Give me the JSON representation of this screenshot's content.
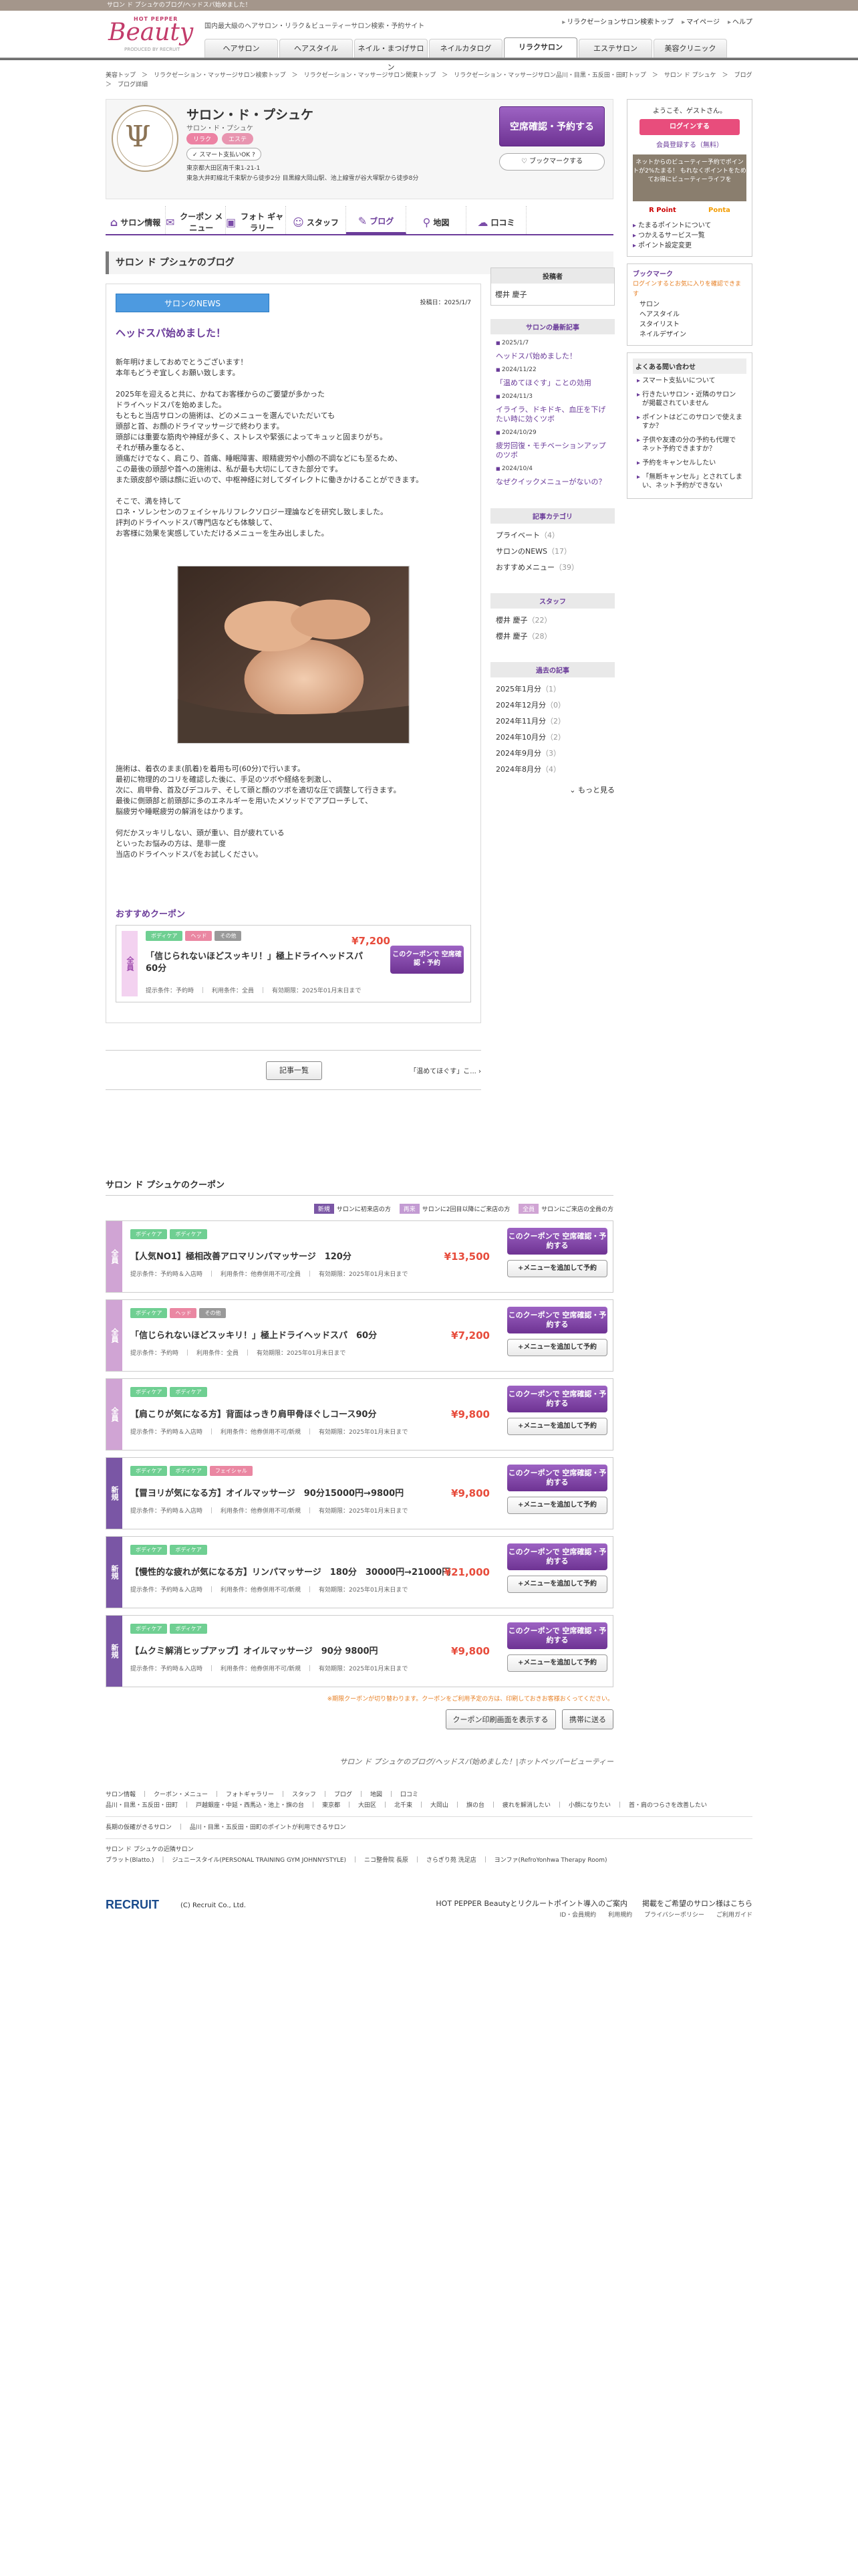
{
  "topbar": "サロン ド プシュケのブログ/ヘッドスパ始めました！",
  "logo": {
    "hp": "HOT PEPPER",
    "beauty": "Beauty",
    "by": "PRODUCED BY RECRUIT"
  },
  "tagline": "国内最大級のヘアサロン・リラク＆ビューティーサロン検索・予約サイト",
  "util": [
    "リラクゼーションサロン検索トップ",
    "マイページ",
    "ヘルプ"
  ],
  "gnav": [
    "ヘアサロン",
    "ヘアスタイル",
    "ネイル・まつげサロン",
    "ネイルカタログ",
    "リラクサロン",
    "エステサロン",
    "美容クリニック"
  ],
  "breadcrumb": "美容トップ　＞　リラクゼーション・マッサージサロン検索トップ　＞　リラクゼーション・マッサージサロン関東トップ　＞　リラクゼーション・マッサージサロン品川・目黒・五反田・田町トップ　＞　サロン ド プシュケ　＞　ブログ　＞　ブログ詳細",
  "shop": {
    "name": "サロン・ド・プシュケ",
    "kana": "サロン・ド・プシュケ",
    "tags": [
      "リラク",
      "エステ"
    ],
    "smart": "スマート支払いOK",
    "addr1": "東京都大田区南千束1-21-1",
    "addr2": "東急大井町線北千束駅から徒歩2分 目黒線大岡山駅、池上線雪が谷大塚駅から徒歩8分",
    "rsv": "空席確認・予約する",
    "bookmark": "ブックマークする"
  },
  "tabs": [
    "サロン情報",
    "クーポン メニュー",
    "フォト ギャラリー",
    "スタッフ",
    "ブログ",
    "地図",
    "口コミ"
  ],
  "blog": {
    "section": "サロン ド プシュケのブログ",
    "category": "サロンのNEWS",
    "date": "投稿日：2025/1/7",
    "title": "ヘッドスパ始めました！",
    "body1": "新年明けましておめでとうございます！\n本年もどうぞ宜しくお願い致します。\n\n2025年を迎えると共に、かねてお客様からのご要望が多かった\nドライヘッドスパを始めました。\nもともと当店サロンの施術は、どのメニューを選んでいただいても\n頭部と首、お顔のドライマッサージで終わります。\n頭部には重要な筋肉や神経が多く、ストレスや緊張によってキュッと固まりがち。\nそれが積み重なると、\n頭痛だけでなく、肩こり、首痛、睡眠障害、眼精疲労や小顔の不調などにも至るため、\nこの最後の頭部や首への施術は、私が最も大切にしてきた部分です。\nまた頭皮部や頭は顔に近いので、中枢神経に対してダイレクトに働きかけることができます。\n\nそこで、満を持して\nロネ・ソレンセンのフェイシャルリフレクソロジー理論などを研究し致しました。\n評判のドライヘッドスパ専門店なども体験して、\nお客様に効果を実感していただけるメニューを生み出しました。",
    "body2": "施術は、着衣のまま(肌着)を着用も可(60分)で行います。\n最初に物理的のコリを確認した後に、手足のツボや経絡を刺激し、\n次に、肩甲骨、首及びデコルテ、そして頭と顔のツボを適切な圧で調整して行きます。\n最後に側頭部と前頭部に多のエネルギーを用いたメソッドでアプローチして、\n脳疲労や睡眠疲労の解消をはかります。\n\n何だかスッキリしない、頭が重い、目が疲れている\nといったお悩みの方は、是非一度\n当店のドライヘッドスパをお試しください。",
    "rec_head": "おすすめクーポン",
    "rec": {
      "band": "全員",
      "cats": [
        "ボディケア",
        "ヘッド",
        "その他"
      ],
      "price": "¥7,200",
      "name": "「信じられないほどスッキリ！」極上ドライヘッドスパ　60分",
      "cond": "提示条件：予約時　｜　利用条件：全員　｜　有効期限：2025年01月末日まで",
      "btn": "このクーポンで 空席確認・予約"
    },
    "list_btn": "記事一覧",
    "next": "「温めてほぐす」こ..."
  },
  "blognav": {
    "author_h": "投稿者",
    "author": "櫻井 慶子",
    "recent_h": "サロンの最新記事",
    "recent": [
      {
        "d": "2025/1/7",
        "t": "ヘッドスパ始めました！"
      },
      {
        "d": "2024/11/22",
        "t": "「温めてほぐす」ことの効用"
      },
      {
        "d": "2024/11/3",
        "t": "イライラ、ドキドキ、血圧を下げたい時に効くツボ"
      },
      {
        "d": "2024/10/29",
        "t": "疲労回復・モチベーションアップのツボ"
      },
      {
        "d": "2024/10/4",
        "t": "なぜクイックメニューがないの？"
      }
    ],
    "cat_h": "記事カテゴリ",
    "cats": [
      {
        "n": "プライベート",
        "c": "（4）"
      },
      {
        "n": "サロンのNEWS",
        "c": "（17）"
      },
      {
        "n": "おすすめメニュー",
        "c": "（39）"
      }
    ],
    "staff_h": "スタッフ",
    "staff": [
      {
        "n": "櫻井 慶子",
        "c": "（22）"
      },
      {
        "n": "櫻井 慶子",
        "c": "（28）"
      }
    ],
    "past_h": "過去の記事",
    "past": [
      {
        "n": "2025年1月分",
        "c": "（1）"
      },
      {
        "n": "2024年12月分",
        "c": "（0）"
      },
      {
        "n": "2024年11月分",
        "c": "（2）"
      },
      {
        "n": "2024年10月分",
        "c": "（2）"
      },
      {
        "n": "2024年9月分",
        "c": "（3）"
      },
      {
        "n": "2024年8月分",
        "c": "（4）"
      }
    ],
    "more": "もっと見る"
  },
  "coupons": {
    "head": "サロン ド プシュケのクーポン",
    "legend": [
      {
        "l": "新規",
        "t": "サロンに初来店の方",
        "c": "#7a56a5"
      },
      {
        "l": "再来",
        "t": "サロンに2回目以降にご来店の方",
        "c": "#c39bd3"
      },
      {
        "l": "全員",
        "t": "サロンにご来店の全員の方",
        "c": "#d0a4d4"
      }
    ],
    "items": [
      {
        "band": "全員",
        "new": false,
        "cats": [
          "ボディケア",
          "ボディケア"
        ],
        "name": "【人気NO1】極相改善アロマリンパマッサージ　120分",
        "price": "¥13,500",
        "cond": "提示条件：予約時＆入店時　｜　利用条件：他券併用不可/全員　｜　有効期限：2025年01月末日まで"
      },
      {
        "band": "全員",
        "new": false,
        "cats": [
          "ボディケア",
          "ヘッド",
          "その他"
        ],
        "name": "「信じられないほどスッキリ！」極上ドライヘッドスパ　60分",
        "price": "¥7,200",
        "cond": "提示条件：予約時　｜　利用条件：全員　｜　有効期限：2025年01月末日まで"
      },
      {
        "band": "全員",
        "new": false,
        "cats": [
          "ボディケア",
          "ボディケア"
        ],
        "name": "【肩こりが気になる方】背面はっきり肩甲骨ほぐしコース90分",
        "price": "¥9,800",
        "cond": "提示条件：予約時＆入店時　｜　利用条件：他券併用不可/新規　｜　有効期限：2025年01月末日まで"
      },
      {
        "band": "新規",
        "new": true,
        "cats": [
          "ボディケア",
          "ボディケア",
          "フェイシャル"
        ],
        "name": "【冒ヨリが気になる方】オイルマッサージ　90分15000円→9800円",
        "price": "¥9,800",
        "cond": "提示条件：予約時＆入店時　｜　利用条件：他券併用不可/新規　｜　有効期限：2025年01月末日まで"
      },
      {
        "band": "新規",
        "new": true,
        "cats": [
          "ボディケア",
          "ボディケア"
        ],
        "name": "【慢性的な疲れが気になる方】リンパマッサージ　180分　30000円→21000円",
        "price": "¥21,000",
        "cond": "提示条件：予約時＆入店時　｜　利用条件：他券併用不可/新規　｜　有効期限：2025年01月末日まで"
      },
      {
        "band": "新規",
        "new": true,
        "cats": [
          "ボディケア",
          "ボディケア"
        ],
        "name": "【ムクミ解消ヒップアップ】オイルマッサージ　90分 9800円",
        "price": "¥9,800",
        "cond": "提示条件：予約時＆入店時　｜　利用条件：他券併用不可/新規　｜　有効期限：2025年01月末日まで"
      }
    ],
    "btn1": "このクーポンで 空席確認・予約する",
    "btn2": "+メニューを追加して予約",
    "note": "※期限クーポンが切り替わります。クーポンをご利用予定の方は、印刷しておきお客様おくってください。",
    "print": "クーポン印刷画面を表示する",
    "mobile": "携帯に送る",
    "caption": "サロン ド プシュケのブログ/ヘッドスパ始めました！|ホットペッパービューティー"
  },
  "side": {
    "welcome": "ようこそ、ゲストさん。",
    "login": "ログインする",
    "register": "会員登録する（無料）",
    "promo": "ネットからのビューティー予約でポイントが2%たまる！ もれなくポイントをためてお得にビューティーライフを",
    "rp": "R Point",
    "pt": "Ponta",
    "links": [
      "たまるポイントについて",
      "つかえるサービス一覧",
      "ポイント設定変更"
    ],
    "bm_h": "ブックマーク",
    "bm_s": "ログインするとお気に入りを確認できます",
    "bm": [
      "サロン",
      "ヘアスタイル",
      "スタイリスト",
      "ネイルデザイン"
    ],
    "faq_h": "よくある問い合わせ",
    "faq": [
      "スマート支払いについて",
      "行きたいサロン・近隣のサロンが掲載されていません",
      "ポイントはどこのサロンで使えますか？",
      "子供や友達の分の予約も代理でネット予約できますか？",
      "予約をキャンセルしたい",
      "「無断キャンセル」とされてしまい、ネット予約ができない"
    ]
  },
  "footer": {
    "l1": "サロン情報　｜　クーポン・メニュー　｜　フォトギャラリー　｜　スタッフ　｜　ブログ　｜　地図　｜　口コミ",
    "l2": "品川・目黒・五反田・田町　｜　戸越銀座・中延・西馬込・池上・旗の台　｜　東京都　｜　大田区　｜　北千束　｜　大岡山　｜　旗の台　｜　疲れを解消したい　｜　小顔になりたい　｜　首・肩のつらさを改善したい",
    "l3": "長期の仮確がきるサロン　｜　品川・目黒・五反田・田町のポイントが利用できるサロン",
    "l4": "サロン ド プシュケの近隣サロン",
    "l5": "ブラット(Blatto.)　｜　ジュニースタイル(PERSONAL TRAINING GYM JOHNNYSTYLE)　｜　ニコ整骨院 長原　｜　さらぎり苑 洗足店　｜　ヨンファ(RefroYonhwa Therapy Room)",
    "recruit": "RECRUIT",
    "copy": "(C) Recruit Co., Ltd.",
    "r1": "HOT PEPPER Beautyとリクルートポイント導入のご案内　　掲載をご希望のサロン様はこちら",
    "r2": "ID・会員規約　　利用規約　　プライバシーポリシー　　ご利用ガイド"
  }
}
